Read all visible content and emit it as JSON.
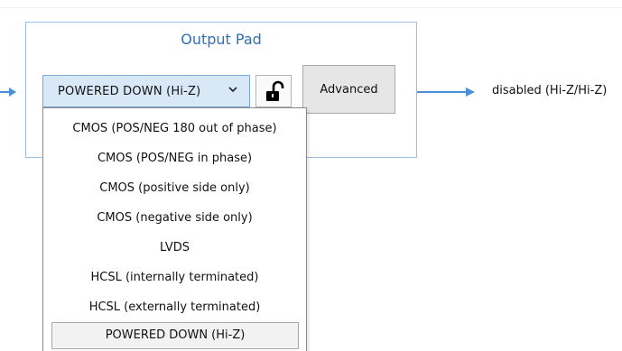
{
  "panel": {
    "title": "Output Pad"
  },
  "output_select": {
    "value": "POWERED DOWN (Hi-Z)"
  },
  "lock_button": {
    "icon": "unlock-icon"
  },
  "advanced_button": {
    "label": "Advanced"
  },
  "output_status": {
    "label": "disabled (Hi-Z/Hi-Z)"
  },
  "dropdown": {
    "options": [
      "CMOS (POS/NEG 180 out of phase)",
      "CMOS (POS/NEG in phase)",
      "CMOS (positive side only)",
      "CMOS (negative side only)",
      "LVDS",
      "HCSL (internally terminated)",
      "HCSL (externally terminated)",
      "POWERED DOWN (Hi-Z)"
    ],
    "selected_index": 7
  },
  "colors": {
    "accent": "#4a90d9",
    "title": "#2f6fb6",
    "select_bg": "#d8e8f7"
  }
}
